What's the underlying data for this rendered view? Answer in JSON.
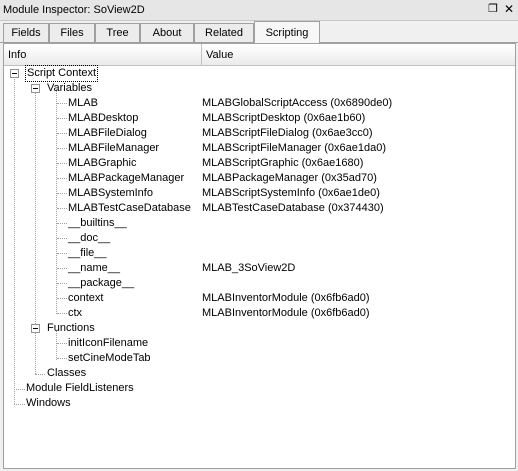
{
  "window": {
    "title": "Module Inspector: SoView2D",
    "float_icon": "restore-icon",
    "close_icon": "close-icon"
  },
  "tabs": [
    {
      "label": "Fields",
      "active": false
    },
    {
      "label": "Files",
      "active": false
    },
    {
      "label": "Tree",
      "active": false
    },
    {
      "label": "About",
      "active": false
    },
    {
      "label": "Related",
      "active": false
    },
    {
      "label": "Scripting",
      "active": true
    }
  ],
  "toolbar": {
    "refresh_icon": "refresh-icon",
    "refresh_color": "#d08a00"
  },
  "columns": {
    "info": "Info",
    "value": "Value"
  },
  "tree": {
    "script_context": "Script Context",
    "variables": "Variables",
    "vars": [
      {
        "name": "MLAB",
        "value": "MLABGlobalScriptAccess (0x6890de0)"
      },
      {
        "name": "MLABDesktop",
        "value": "MLABScriptDesktop (0x6ae1b60)"
      },
      {
        "name": "MLABFileDialog",
        "value": "MLABScriptFileDialog (0x6ae3cc0)"
      },
      {
        "name": "MLABFileManager",
        "value": "MLABScriptFileManager (0x6ae1da0)"
      },
      {
        "name": "MLABGraphic",
        "value": "MLABScriptGraphic (0x6ae1680)"
      },
      {
        "name": "MLABPackageManager",
        "value": "MLABPackageManager (0x35ad70)"
      },
      {
        "name": "MLABSystemInfo",
        "value": "MLABScriptSystemInfo (0x6ae1de0)"
      },
      {
        "name": "MLABTestCaseDatabase",
        "value": "MLABTestCaseDatabase (0x374430)"
      },
      {
        "name": "__builtins__",
        "value": ""
      },
      {
        "name": "__doc__",
        "value": ""
      },
      {
        "name": "__file__",
        "value": ""
      },
      {
        "name": "__name__",
        "value": "MLAB_3SoView2D"
      },
      {
        "name": "__package__",
        "value": ""
      },
      {
        "name": "context",
        "value": "MLABInventorModule (0x6fb6ad0)"
      },
      {
        "name": "ctx",
        "value": "MLABInventorModule (0x6fb6ad0)"
      }
    ],
    "functions": "Functions",
    "funcs": [
      {
        "name": "initIconFilename"
      },
      {
        "name": "setCineModeTab"
      }
    ],
    "classes": "Classes",
    "module_field_listeners": "Module FieldListeners",
    "windows": "Windows"
  }
}
